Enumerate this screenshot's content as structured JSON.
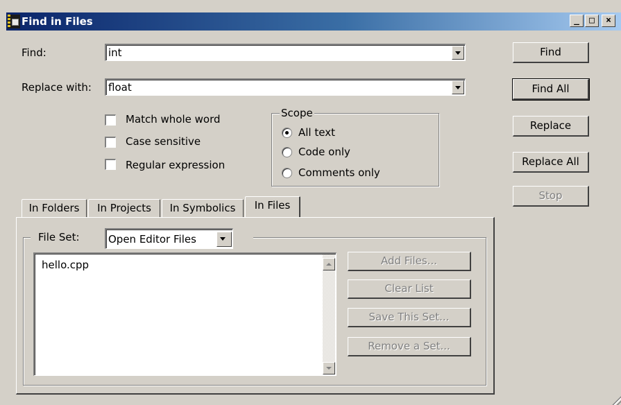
{
  "window": {
    "title": "Find in Files",
    "controls": [
      "_",
      "□",
      "×"
    ]
  },
  "find": {
    "label": "Find:",
    "value": "int"
  },
  "replace": {
    "label": "Replace with:",
    "value": "float"
  },
  "options": {
    "match_whole_word": {
      "label": "Match whole word",
      "checked": false
    },
    "case_sensitive": {
      "label": "Case sensitive",
      "checked": false
    },
    "regular_expression": {
      "label": "Regular expression",
      "checked": false
    }
  },
  "scope": {
    "title": "Scope",
    "options": [
      "All text",
      "Code only",
      "Comments only"
    ],
    "selected": "All text"
  },
  "buttons": {
    "find": "Find",
    "find_all": "Find All",
    "replace": "Replace",
    "replace_all": "Replace All",
    "stop": "Stop"
  },
  "tabs": [
    "In Folders",
    "In Projects",
    "In Symbolics",
    "In Files"
  ],
  "active_tab": "In Files",
  "file_set": {
    "label": "File Set:",
    "value": "Open Editor Files",
    "files": [
      "hello.cpp"
    ],
    "buttons": {
      "add_files": "Add Files...",
      "clear_list": "Clear List",
      "save_set": "Save This Set...",
      "remove_set": "Remove a Set..."
    }
  }
}
